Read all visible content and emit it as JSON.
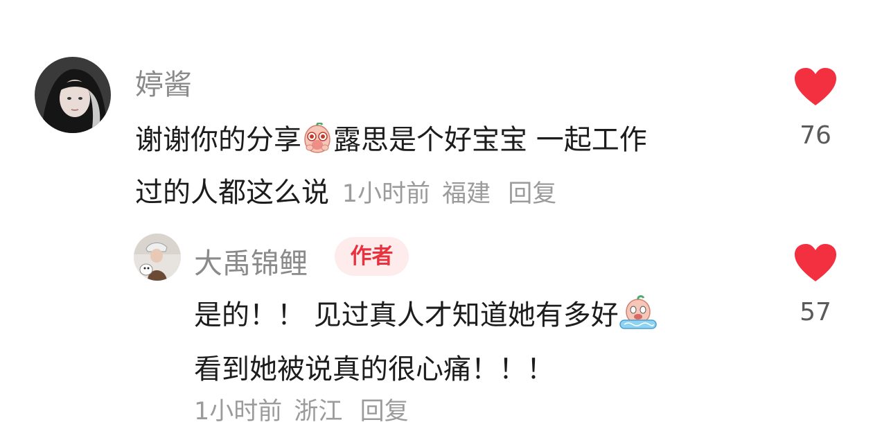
{
  "comments": [
    {
      "username": "婷酱",
      "text_line1": "谢谢你的分享",
      "text_line1b": "露思是个好宝宝 一起工作",
      "text_line2": "过的人都这么说",
      "time": "1小时前",
      "location": "福建",
      "reply_label": "回复",
      "like_count": "76",
      "emoji": "shy-peach-emoji"
    },
    {
      "username": "大禹锦鲤",
      "badge": "作者",
      "text_line1": "是的！！ 见过真人才知道她有多好",
      "text_line2": "看到她被说真的很心痛！！！",
      "time": "1小时前",
      "location": "浙江",
      "reply_label": "回复",
      "like_count": "57",
      "emoji": "crying-peach-emoji"
    }
  ],
  "colors": {
    "heart": "#f2303f",
    "badge_bg": "#fdeceb",
    "badge_text": "#e8333f",
    "username": "#8a8a8a",
    "meta": "#9b9b9b"
  }
}
